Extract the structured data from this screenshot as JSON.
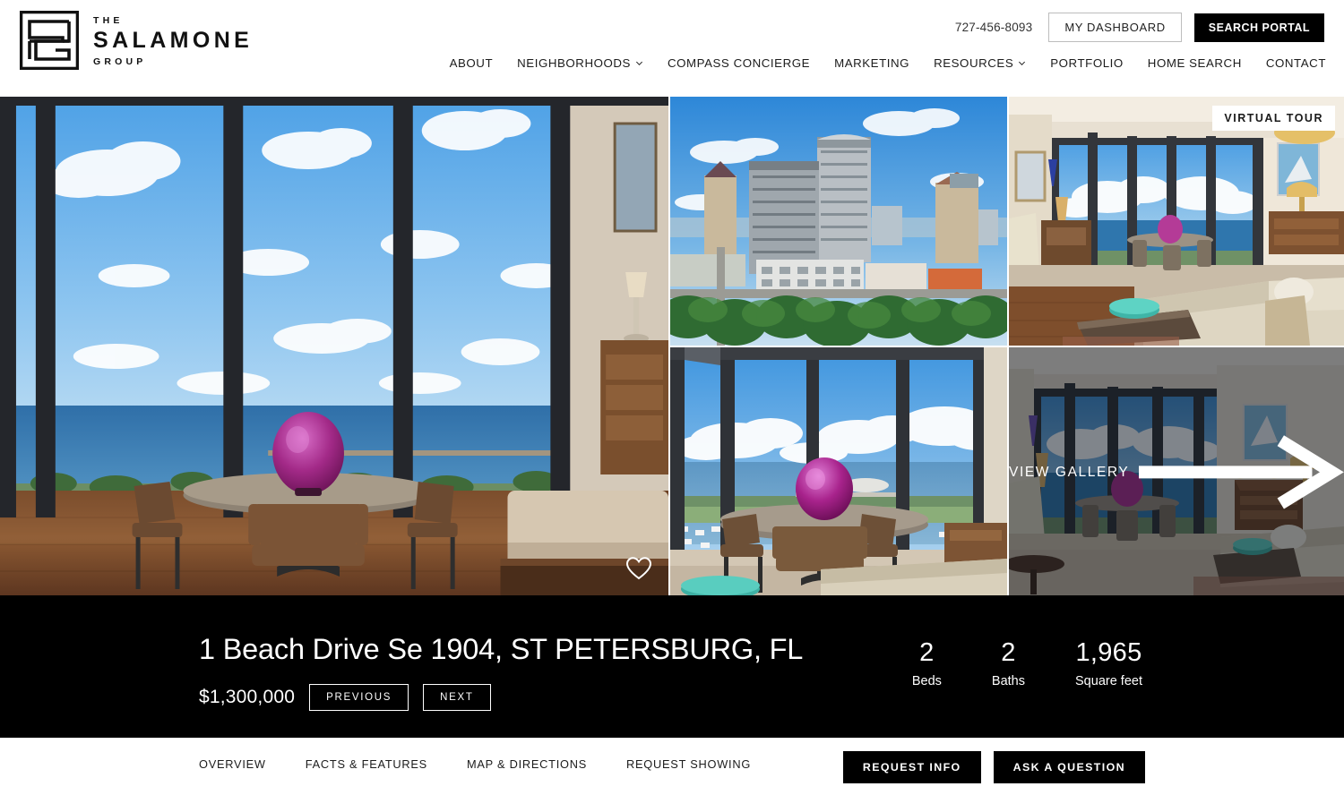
{
  "brand": {
    "logo_icon": "salamone-sg-monogram-icon",
    "line1": "THE",
    "line2": "SALAMONE",
    "line3": "GROUP"
  },
  "header": {
    "phone": "727-456-8093",
    "dashboard_label": "MY DASHBOARD",
    "search_portal_label": "SEARCH PORTAL",
    "nav": [
      {
        "label": "ABOUT",
        "has_dropdown": false
      },
      {
        "label": "NEIGHBORHOODS",
        "has_dropdown": true
      },
      {
        "label": "COMPASS CONCIERGE",
        "has_dropdown": false
      },
      {
        "label": "MARKETING",
        "has_dropdown": false
      },
      {
        "label": "RESOURCES",
        "has_dropdown": true
      },
      {
        "label": "PORTFOLIO",
        "has_dropdown": false
      },
      {
        "label": "HOME SEARCH",
        "has_dropdown": false
      },
      {
        "label": "CONTACT",
        "has_dropdown": false
      }
    ]
  },
  "gallery": {
    "virtual_tour_badge": "VIRTUAL TOUR",
    "view_gallery_label": "VIEW GALLERY",
    "favorite_icon": "heart-icon",
    "arrow_icon": "arrow-right-icon",
    "tiles": [
      {
        "name": "hero-dining-room-water-view"
      },
      {
        "name": "aerial-downtown-skyline"
      },
      {
        "name": "living-room-corner-windows"
      },
      {
        "name": "dining-table-bay-view"
      },
      {
        "name": "wide-living-room-view"
      }
    ]
  },
  "listing": {
    "address": "1 Beach Drive Se 1904, ST PETERSBURG, FL",
    "price": "$1,300,000",
    "previous_label": "PREVIOUS",
    "next_label": "NEXT",
    "stats": [
      {
        "value": "2",
        "label": "Beds"
      },
      {
        "value": "2",
        "label": "Baths"
      },
      {
        "value": "1,965",
        "label": "Square feet"
      }
    ]
  },
  "tabs": [
    {
      "label": "OVERVIEW"
    },
    {
      "label": "FACTS & FEATURES"
    },
    {
      "label": "MAP & DIRECTIONS"
    },
    {
      "label": "REQUEST SHOWING"
    }
  ],
  "actions": {
    "request_info": "REQUEST INFO",
    "ask_question": "ASK A QUESTION"
  },
  "colors": {
    "accent_black": "#000000",
    "text": "#1c1c1c",
    "border": "#bdbdbd"
  }
}
